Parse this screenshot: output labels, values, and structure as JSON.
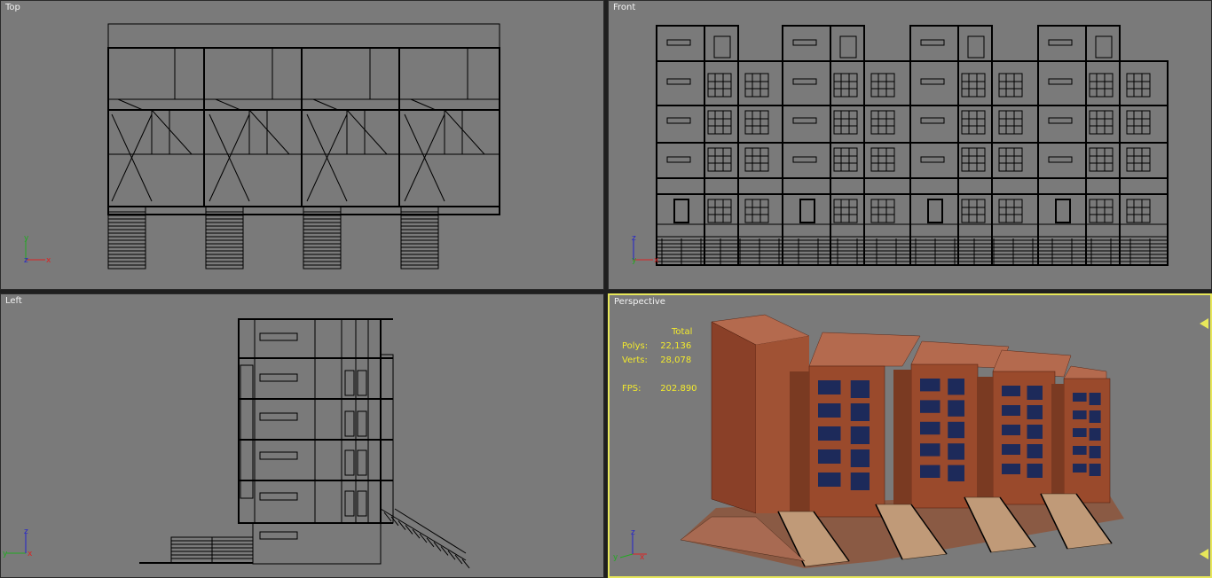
{
  "viewports": {
    "top": {
      "label": "Top"
    },
    "front": {
      "label": "Front"
    },
    "left": {
      "label": "Left"
    },
    "perspective": {
      "label": "Perspective",
      "stats": {
        "total_label": "Total",
        "polys_label": "Polys:",
        "polys_value": "22,136",
        "verts_label": "Verts:",
        "verts_value": "28,078",
        "fps_label": "FPS:",
        "fps_value": "202.890"
      }
    }
  },
  "axis_labels": {
    "x": "x",
    "y": "y",
    "z": "z"
  },
  "colors": {
    "viewport_bg": "#7a7a7a",
    "wire": "#000000",
    "active_border": "#e7e75a",
    "stats_text": "#f3ea2c",
    "brick": "#9a4a2c",
    "window": "#1d2a5a"
  }
}
